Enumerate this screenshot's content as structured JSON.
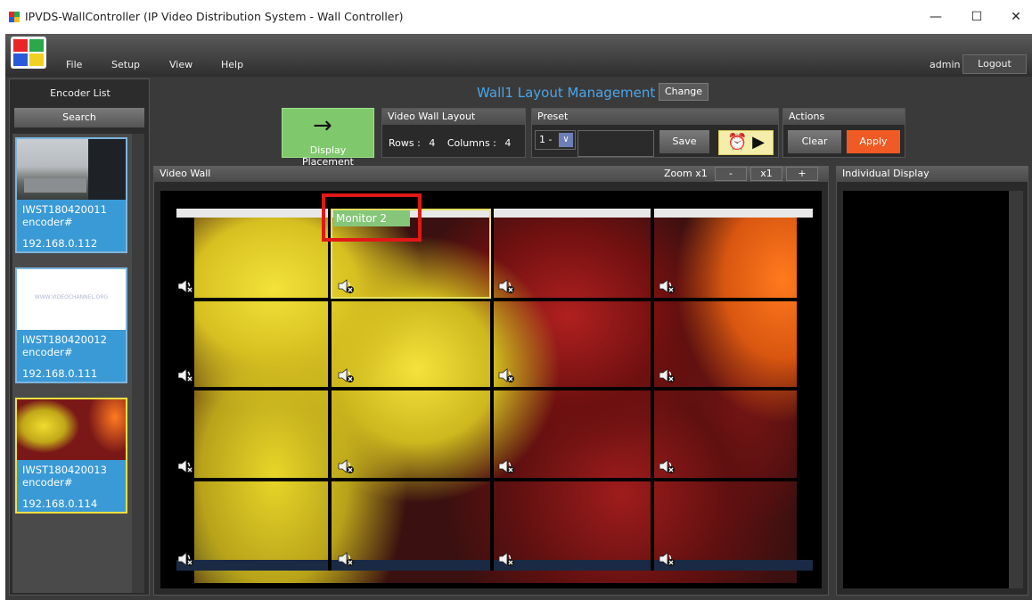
{
  "window": {
    "title": "IPVDS-WallController (IP Video Distribution System - Wall Controller)",
    "minimize": "—",
    "maximize": "☐",
    "close": "✕"
  },
  "menu": {
    "items": [
      "File",
      "Setup",
      "View",
      "Help"
    ],
    "user": "admin",
    "logout": "Logout"
  },
  "encoders": {
    "title": "Encoder List",
    "search": "Search",
    "items": [
      {
        "id": "IWST180420011",
        "type": "encoder#",
        "ip": "192.168.0.112",
        "selected": false
      },
      {
        "id": "IWST180420012",
        "type": "encoder#",
        "ip": "192.168.0.111",
        "selected": false
      },
      {
        "id": "IWST180420013",
        "type": "encoder#",
        "ip": "192.168.0.114",
        "selected": true
      }
    ],
    "thumb2_text": "WWW.VIDEOCHANNEL.ORG"
  },
  "header": {
    "title": "Wall1 Layout Management",
    "change": "Change",
    "display_placement": "Display Placement",
    "display_arrow": "→"
  },
  "layout": {
    "title": "Video Wall Layout",
    "rows_label": "Rows :",
    "rows": "4",
    "cols_label": "Columns :",
    "cols": "4"
  },
  "preset": {
    "title": "Preset",
    "selected": "1 -",
    "save": "Save",
    "alarm_play": "⏰ ▶"
  },
  "actions": {
    "title": "Actions",
    "clear": "Clear",
    "apply": "Apply"
  },
  "videowall": {
    "title": "Video Wall",
    "zoom_label": "Zoom x1",
    "zoom_minus": "-",
    "zoom_reset": "x1",
    "zoom_plus": "+",
    "selected_monitor": "Monitor 2"
  },
  "individual": {
    "title": "Individual Display"
  },
  "colors": {
    "accent_blue": "#4aa6ea",
    "apply_orange": "#f05a24",
    "placement_green": "#7fc86c",
    "highlight_red": "#e01818",
    "encoder_blue": "#3a9ad6"
  }
}
